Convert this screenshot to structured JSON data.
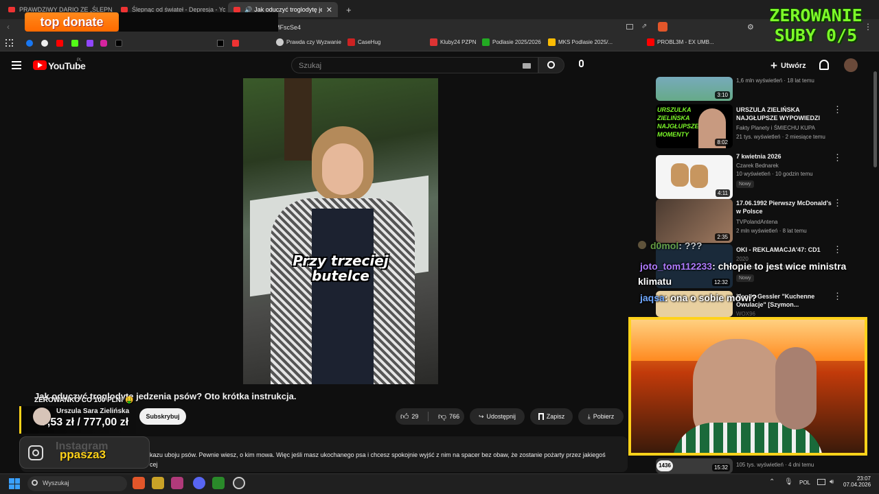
{
  "tabs": [
    {
      "label": "PRAWDZIWY DARIO ZE „ŚLEPNĄC OD"
    },
    {
      "label": "Ślepnąc od świateł - Depresja - YouTu"
    },
    {
      "label": "Jak oduczyć troglodytę jedzenia"
    }
  ],
  "address": {
    "url_fragment": "MFscSe4"
  },
  "bookmarks": [
    "Prawda czy Wyzwanie",
    "CaseHug",
    "Kluby24 PZPN",
    "Podlasie 2025/2026",
    "MKS Podlasie 2025/...",
    "PROBL3M - EX UMB..."
  ],
  "overlay": {
    "top_donate": "top donate",
    "zero_line1": "ZEROWANIE",
    "zero_line2": "SUBY 0/5",
    "zerowanko": "ZEROWANKO CO 100 PLN! 🤑",
    "amount": "7,53 zł / 777,00 zł",
    "instagram_label": "Instagram",
    "instagram_user": "ppasza3",
    "viewer_count": "1436"
  },
  "youtube": {
    "logo": "YouTube",
    "logo_country": "PL",
    "search_placeholder": "Szukaj",
    "create_label": "Utwórz",
    "video_caption_line1": "Przy trzeciej",
    "video_caption_line2": "butelce",
    "video_title": "Jak oduczyć troglodytę jedzenia psów? Oto krótka instrukcja.",
    "channel": "Urszula Sara Zielińska",
    "subscribe": "Subskrybuj",
    "likes": "29",
    "dislikes": "766",
    "share": "Udostępnij",
    "save": "Zapisz",
    "download": "Pobierz",
    "description": "kazu uboju psów. Pewnie wiesz, o kim mowa. Więc jeśli masz ukochanego psa i chcesz spokojnie wyjść z nim na spacer bez obaw, że zostanie pożarty przez jakiegoś",
    "description_line2": "cej"
  },
  "related": [
    {
      "title": "",
      "meta1": "1,6 mln wyświetleń · 18 lat temu",
      "meta2": "",
      "duration": "3:10",
      "new": ""
    },
    {
      "title": "URSZULA ZIELIŃSKA NAJGŁUPSZE WYPOWIEDZI",
      "meta1": "Fakty Planety i ŚMIECHU KUPA",
      "meta2": "21 tys. wyświetleń · 2 miesiące temu",
      "duration": "8:02",
      "new": "",
      "thumb_text": "URSZULKA ZIELIŃSKA NAJGŁUPSZE MOMENTY"
    },
    {
      "title": "7 kwietnia 2026",
      "meta1": "Czarek Bednarek",
      "meta2": "10 wyświetleń · 10 godzin temu",
      "duration": "4:11",
      "new": "Nowy"
    },
    {
      "title": "17.06.1992 Pierwszy McDonald's w Polsce",
      "meta1": "TVPolandAntena",
      "meta2": "2 mln wyświetleń · 8 lat temu",
      "duration": "2:35",
      "new": ""
    },
    {
      "title": "OKI - REKLAMACJA'47: CD1",
      "meta1": "2020",
      "meta2": "wyświetleń · 6 godzin temu",
      "duration": "12:32",
      "new": "Nowy"
    },
    {
      "title": "Magdy Gessler \"Kuchenne Owulacje\" [Szymon...",
      "meta1": "WOX96",
      "meta2": "",
      "duration": "",
      "new": ""
    },
    {
      "title": "",
      "meta1": "105 tys. wyświetleń · 4 dni temu",
      "meta2": "",
      "duration": "15:32",
      "new": ""
    }
  ],
  "chat": [
    {
      "user": "d0mol",
      "text": ": ???",
      "color": "#7ec850"
    },
    {
      "user": "joto_tom112233",
      "text": ": chłopie to jest wice ministra",
      "text2": "klimatu",
      "color": "#b07cff"
    },
    {
      "user": "jaqsa",
      "text": ": ona o sobie mówi?",
      "color": "#6fa8ff"
    }
  ],
  "taskbar": {
    "search": "Wyszukaj",
    "lang": "POL",
    "time": "23:07",
    "date": "07.04.2026"
  },
  "colors": {
    "accent_red": "#ff0000",
    "yellow_border": "#ffd21a",
    "neon_green": "#7dfa29",
    "donate_orange": "#ff7a10"
  }
}
